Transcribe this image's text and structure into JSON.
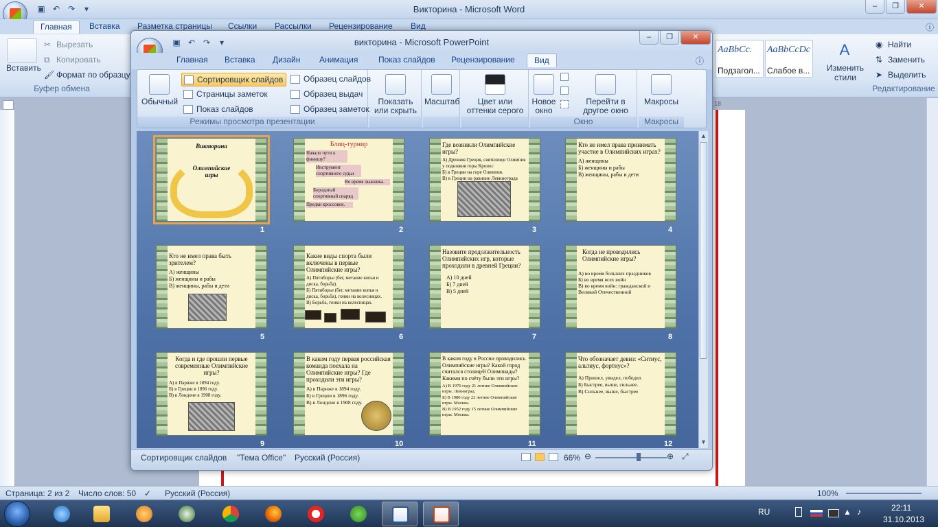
{
  "word": {
    "title": "Викторина - Microsoft Word",
    "tabs": [
      "Главная",
      "Вставка",
      "Разметка страницы",
      "Ссылки",
      "Рассылки",
      "Рецензирование",
      "Вид"
    ],
    "clipboard": {
      "paste": "Вставить",
      "cut": "Вырезать",
      "copy": "Копировать",
      "format_painter": "Формат по образцу",
      "group": "Буфер обмена"
    },
    "styles": [
      {
        "sample": "AaBbCc.",
        "name": "Подзагол..."
      },
      {
        "sample": "AaBbCcDc",
        "name": "Слабое в..."
      }
    ],
    "change_styles": "Изменить стили",
    "editing": {
      "find": "Найти",
      "replace": "Заменить",
      "select": "Выделить",
      "group": "Редактирование"
    },
    "ruler_mark": "18",
    "status": {
      "page": "Страница: 2 из 2",
      "words": "Число слов: 50",
      "language": "Русский (Россия)",
      "zoom": "100%"
    }
  },
  "ppt": {
    "title": "викторина - Microsoft PowerPoint",
    "tabs": [
      "Главная",
      "Вставка",
      "Дизайн",
      "Анимация",
      "Показ слайдов",
      "Рецензирование",
      "Вид"
    ],
    "ribbon": {
      "normal": "Обычный",
      "sorter": "Сортировщик слайдов",
      "notes_page": "Страницы заметок",
      "slide_show": "Показ слайдов",
      "slide_master": "Образец слайдов",
      "handout_master": "Образец выдач",
      "notes_master": "Образец заметок",
      "views_group": "Режимы просмотра презентации",
      "show_hide": "Показать или скрыть",
      "zoom": "Масштаб",
      "color_gray": "Цвет или оттенки серого",
      "new_window": "Новое окно",
      "switch_window": "Перейти в другое окно",
      "window_group": "Окно",
      "macros": "Макросы",
      "macros_group": "Макросы"
    },
    "slides": [
      {
        "num": "1",
        "title": "Викторина",
        "subtitle": "Олимпийские игры",
        "lines": []
      },
      {
        "num": "2",
        "title": "Блиц-турнир",
        "lines": [
          "Начало пути к финишу?",
          "Инструмент спортивного судьи",
          "Во время лыжника.",
          "Бородатый спортивный снаряд",
          "Предки кроссовок."
        ]
      },
      {
        "num": "3",
        "title": "Где возникли Олимпийские игры?",
        "lines": [
          "А) Древняя Греция, святилище Олимпия у подножия горы Кронос",
          "Б) в Греции на горе Олимпия.",
          "В) в Греции на равнине Левинограда"
        ]
      },
      {
        "num": "4",
        "title": "Кто не имел права принимать участие в Олимпийских играх?",
        "lines": [
          "А) женщины",
          "Б) женщины и рабы",
          "В) женщины, рабы и дети"
        ]
      },
      {
        "num": "5",
        "title": "Кто не имел права быть зрителем?",
        "lines": [
          "А) женщины",
          "Б) женщины и рабы",
          "В) женщины, рабы и дети"
        ]
      },
      {
        "num": "6",
        "title": "Какие виды спорта были включены в первые Олимпийские игры?",
        "lines": [
          "А) Пятиборье (бег, метание копья и диска, борьба).",
          "Б) Пятиборье (бег, метание копья и диска, борьба), гонки на колесницах.",
          "В) Борьба, гонки на колесницах."
        ]
      },
      {
        "num": "7",
        "title": "Назовите продолжительность Олимпийских игр, которые проходили в древней Греции?",
        "lines": [
          "А) 10 дней",
          "Б) 7 дней",
          "В) 5 дней"
        ]
      },
      {
        "num": "8",
        "title": "Когда не проводились Олимпийские игры?",
        "lines": [
          "А) во время больших праздников",
          "Б) во время всех войн",
          "В) во время войн: гражданской и Великой Отечественной"
        ]
      },
      {
        "num": "9",
        "title": "Когда и где прошли первые современные Олимпийские игры?",
        "lines": [
          "А) в Париже в 1894 году.",
          "Б) в Греции в 1896 году.",
          "В) в Лондоне в 1908 году."
        ]
      },
      {
        "num": "10",
        "title": "В каком году первая российская команда поехала на Олимпийские игры? Где проходили эти игры?",
        "lines": [
          "А) в Париже в 1894 году.",
          "Б) в Греции в 1896 году.",
          "В) в Лондоне в 1908 году."
        ]
      },
      {
        "num": "11",
        "title": "В каком году в России проводились Олимпийские игры? Какой город считался столицей Олимпиады? Какими по счёту были эти игры?",
        "lines": [
          "А) В 1976 году 21 летние Олимпийские игры. Ленинград.",
          "Б) В 1980 году 22 летние Олимпийские игры. Москва.",
          "В) В 1952 году 15 летние Олимпийские игры. Москва."
        ]
      },
      {
        "num": "12",
        "title": "Что обозначает девиз: «Ситиус, альтиус, фортиус»?",
        "lines": [
          "А) Пришел, увидел, победил",
          "Б) Быстрее, выше, сильнее.",
          "В) Сильнее, выше, быстрее"
        ]
      }
    ],
    "status": {
      "view": "Сортировщик слайдов",
      "theme": "\"Тема Office\"",
      "language": "Русский (Россия)",
      "zoom": "66%"
    }
  },
  "tray": {
    "lang": "RU",
    "time": "22:11",
    "date": "31.10.2013"
  }
}
